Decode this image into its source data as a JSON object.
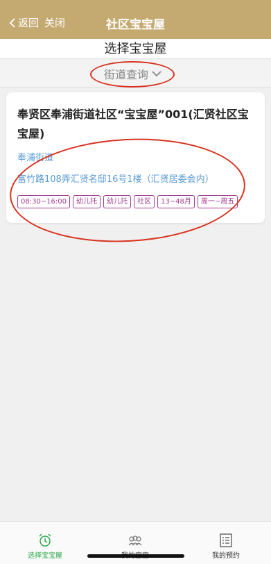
{
  "nav": {
    "back_label": "返回",
    "close_label": "关闭",
    "title": "社区宝宝屋"
  },
  "page": {
    "title": "选择宝宝屋"
  },
  "filter": {
    "label": "街道查询"
  },
  "card": {
    "title": "奉贤区奉浦街道社区“宝宝屋”001(汇贤社区宝宝屋)",
    "street": "奉浦街道",
    "address": "富竹路108弄汇贤名邸16号1楼（汇贤居委会内）",
    "tags": [
      "08:30~16:00",
      "幼儿托",
      "幼儿托",
      "社区",
      "13~48月",
      "周一~周五"
    ]
  },
  "tabs": [
    {
      "label": "选择宝宝屋",
      "icon": "alarm-clock-icon"
    },
    {
      "label": "我的宝宝",
      "icon": "babies-icon"
    },
    {
      "label": "我的预约",
      "icon": "list-icon"
    }
  ],
  "colors": {
    "nav_bg": "#c4a971",
    "link": "#5a9bd8",
    "tag": "#a43a8e",
    "tab_active": "#2da84c",
    "annotation": "#d8311d"
  }
}
